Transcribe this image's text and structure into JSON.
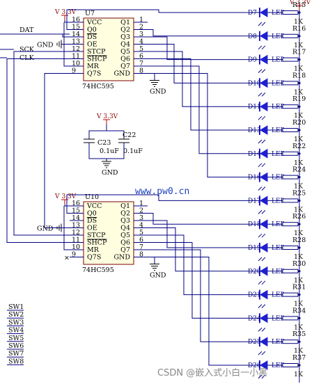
{
  "power": {
    "vcc": "V 3.3V",
    "gnd": "GND"
  },
  "chips": [
    {
      "ref": "U7",
      "part": "74HC595",
      "left_pins": [
        {
          "num": "16",
          "name": "VCC"
        },
        {
          "num": "15",
          "name": "Q0"
        },
        {
          "num": "14",
          "name": "DS"
        },
        {
          "num": "13",
          "name": "OE"
        },
        {
          "num": "12",
          "name": "STCP"
        },
        {
          "num": "11",
          "name": "SHCP"
        },
        {
          "num": "10",
          "name": "MR"
        },
        {
          "num": "9",
          "name": "Q7S"
        }
      ],
      "right_pins": [
        {
          "num": "1",
          "name": "Q1"
        },
        {
          "num": "2",
          "name": "Q2"
        },
        {
          "num": "3",
          "name": "Q3"
        },
        {
          "num": "4",
          "name": "Q4"
        },
        {
          "num": "5",
          "name": "Q5"
        },
        {
          "num": "6",
          "name": "Q6"
        },
        {
          "num": "7",
          "name": "Q7"
        },
        {
          "num": "8",
          "name": "GND"
        }
      ]
    },
    {
      "ref": "U10",
      "part": "74HC595",
      "left_pins": [
        {
          "num": "16",
          "name": "VCC"
        },
        {
          "num": "15",
          "name": "Q0"
        },
        {
          "num": "14",
          "name": "DS"
        },
        {
          "num": "13",
          "name": "OE"
        },
        {
          "num": "12",
          "name": "STCP"
        },
        {
          "num": "11",
          "name": "SHCP"
        },
        {
          "num": "10",
          "name": "MR"
        },
        {
          "num": "9",
          "name": "Q7S"
        }
      ],
      "right_pins": [
        {
          "num": "1",
          "name": "Q1"
        },
        {
          "num": "2",
          "name": "Q2"
        },
        {
          "num": "3",
          "name": "Q3"
        },
        {
          "num": "4",
          "name": "Q4"
        },
        {
          "num": "5",
          "name": "Q5"
        },
        {
          "num": "6",
          "name": "Q6"
        },
        {
          "num": "7",
          "name": "Q7"
        },
        {
          "num": "8",
          "name": "GND"
        }
      ]
    }
  ],
  "nets": [
    "DAT",
    "SCK",
    "CLK"
  ],
  "caps": [
    {
      "ref": "C23",
      "value": "0.1uF"
    },
    {
      "ref": "C22",
      "value": "0.1uF"
    }
  ],
  "leds": [
    {
      "ref": "D7",
      "type": "LED",
      "res": "R15",
      "val": "1K"
    },
    {
      "ref": "D8",
      "type": "LED",
      "res": "R16",
      "val": "1K"
    },
    {
      "ref": "D9",
      "type": "LED",
      "res": "R17",
      "val": "1K"
    },
    {
      "ref": "D10",
      "type": "LED",
      "res": "R18",
      "val": "1K"
    },
    {
      "ref": "D11",
      "type": "LED",
      "res": "R19",
      "val": "1K"
    },
    {
      "ref": "D13",
      "type": "LED",
      "res": "R20",
      "val": "1K"
    },
    {
      "ref": "D14",
      "type": "LED",
      "res": "R22",
      "val": "1K"
    },
    {
      "ref": "D16",
      "type": "LED",
      "res": "R24",
      "val": "1K"
    },
    {
      "ref": "D17",
      "type": "LED",
      "res": "R25",
      "val": "1K"
    },
    {
      "ref": "D18",
      "type": "LED",
      "res": "R26",
      "val": "1K"
    },
    {
      "ref": "D19",
      "type": "LED",
      "res": "R28",
      "val": "1K"
    },
    {
      "ref": "D20",
      "type": "LED",
      "res": "R30",
      "val": "1K"
    },
    {
      "ref": "D21",
      "type": "LED",
      "res": "R31",
      "val": "1K"
    },
    {
      "ref": "D24",
      "type": "LED",
      "res": "R34",
      "val": "1K"
    },
    {
      "ref": "D25",
      "type": "LED",
      "res": "R35",
      "val": "1K"
    },
    {
      "ref": "D26",
      "type": "LED",
      "res": "R37",
      "val": "1K"
    }
  ],
  "switches": [
    "SW1",
    "SW2",
    "SW3",
    "SW4",
    "SW5",
    "SW6",
    "SW7",
    "SW8"
  ],
  "watermark": "www.pw0.cn",
  "credit": "CSDN @嵌入式小白一小黑",
  "colors": {
    "wire": "#000080",
    "led": "#1f1fd0",
    "chip_fill": "#ffffe0",
    "power": "#c00000"
  }
}
